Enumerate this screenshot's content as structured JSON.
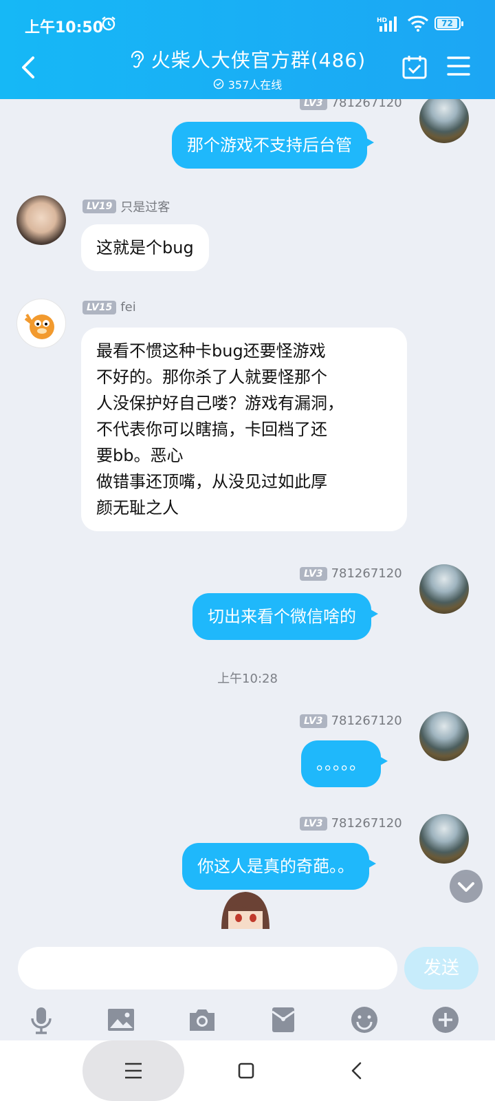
{
  "status_bar": {
    "time": "上午10:50",
    "signal_label": "HD",
    "battery": "72"
  },
  "header": {
    "title": "火柴人大侠官方群(486)",
    "online": "357人在线"
  },
  "messages": [
    {
      "level": "LV3",
      "name": "781267120",
      "lines": [
        "那个游戏不支持后台管"
      ]
    },
    {
      "level": "LV19",
      "name": "只是过客",
      "lines": [
        "这就是个bug"
      ]
    },
    {
      "level": "LV15",
      "name": "fei",
      "lines": [
        "最看不惯这种卡bug还要怪游戏",
        "不好的。那你杀了人就要怪那个",
        "人没保护好自己喽？游戏有漏洞，",
        "不代表你可以瞎搞，卡回档了还",
        "要bb。恶心",
        "做错事还顶嘴，从没见过如此厚",
        "颜无耻之人"
      ]
    },
    {
      "level": "LV3",
      "name": "781267120",
      "lines": [
        "切出来看个微信啥的"
      ]
    },
    {
      "level": "LV3",
      "name": "781267120",
      "lines": [
        "。。。。。"
      ]
    },
    {
      "level": "LV3",
      "name": "781267120",
      "lines": [
        "你这人是真的奇葩。。"
      ]
    }
  ],
  "timestamp": "上午10:28",
  "input": {
    "placeholder": "",
    "send_label": "发送"
  },
  "icons": {
    "back": "back-arrow-icon",
    "ear": "ear-icon",
    "calendar": "calendar-check-icon",
    "menu": "menu-icon",
    "tools": [
      "microphone-icon",
      "image-icon",
      "camera-icon",
      "red-packet-icon",
      "emoji-icon",
      "plus-icon"
    ]
  },
  "colors": {
    "header": "#1ab2f6",
    "bubble_out": "#1fb8fb",
    "bubble_in": "#ffffff",
    "background": "#eceff5"
  }
}
